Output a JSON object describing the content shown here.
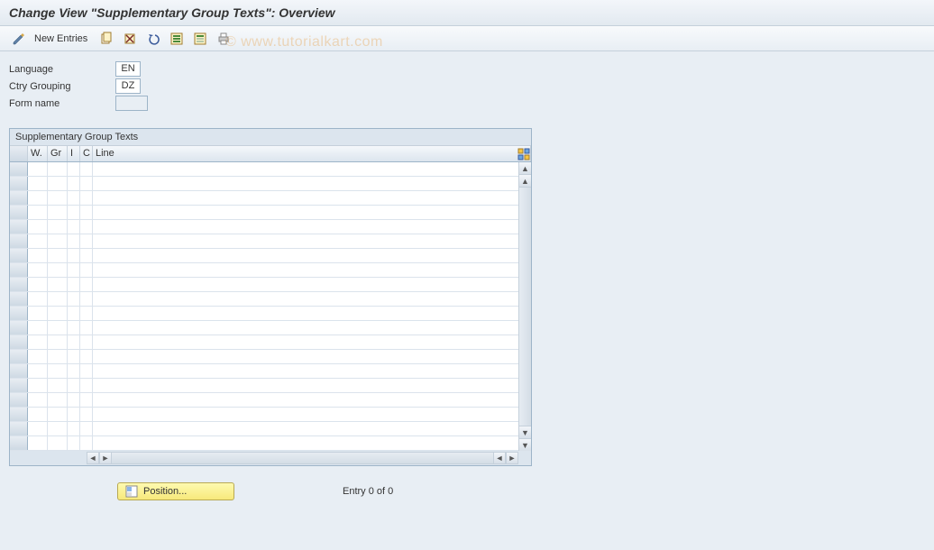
{
  "title": "Change View \"Supplementary Group Texts\": Overview",
  "toolbar": {
    "new_entries_label": "New Entries"
  },
  "watermark": "© www.tutorialkart.com",
  "form": {
    "language": {
      "label": "Language",
      "value": "EN"
    },
    "ctry_grouping": {
      "label": "Ctry Grouping",
      "value": "DZ"
    },
    "form_name": {
      "label": "Form name",
      "value": ""
    }
  },
  "table": {
    "title": "Supplementary Group Texts",
    "columns": {
      "w": "W.",
      "gr": "Gr",
      "i": "I",
      "c": "C",
      "line": "Line"
    },
    "rows": []
  },
  "footer": {
    "position_label": "Position...",
    "entry_text": "Entry 0 of 0"
  }
}
